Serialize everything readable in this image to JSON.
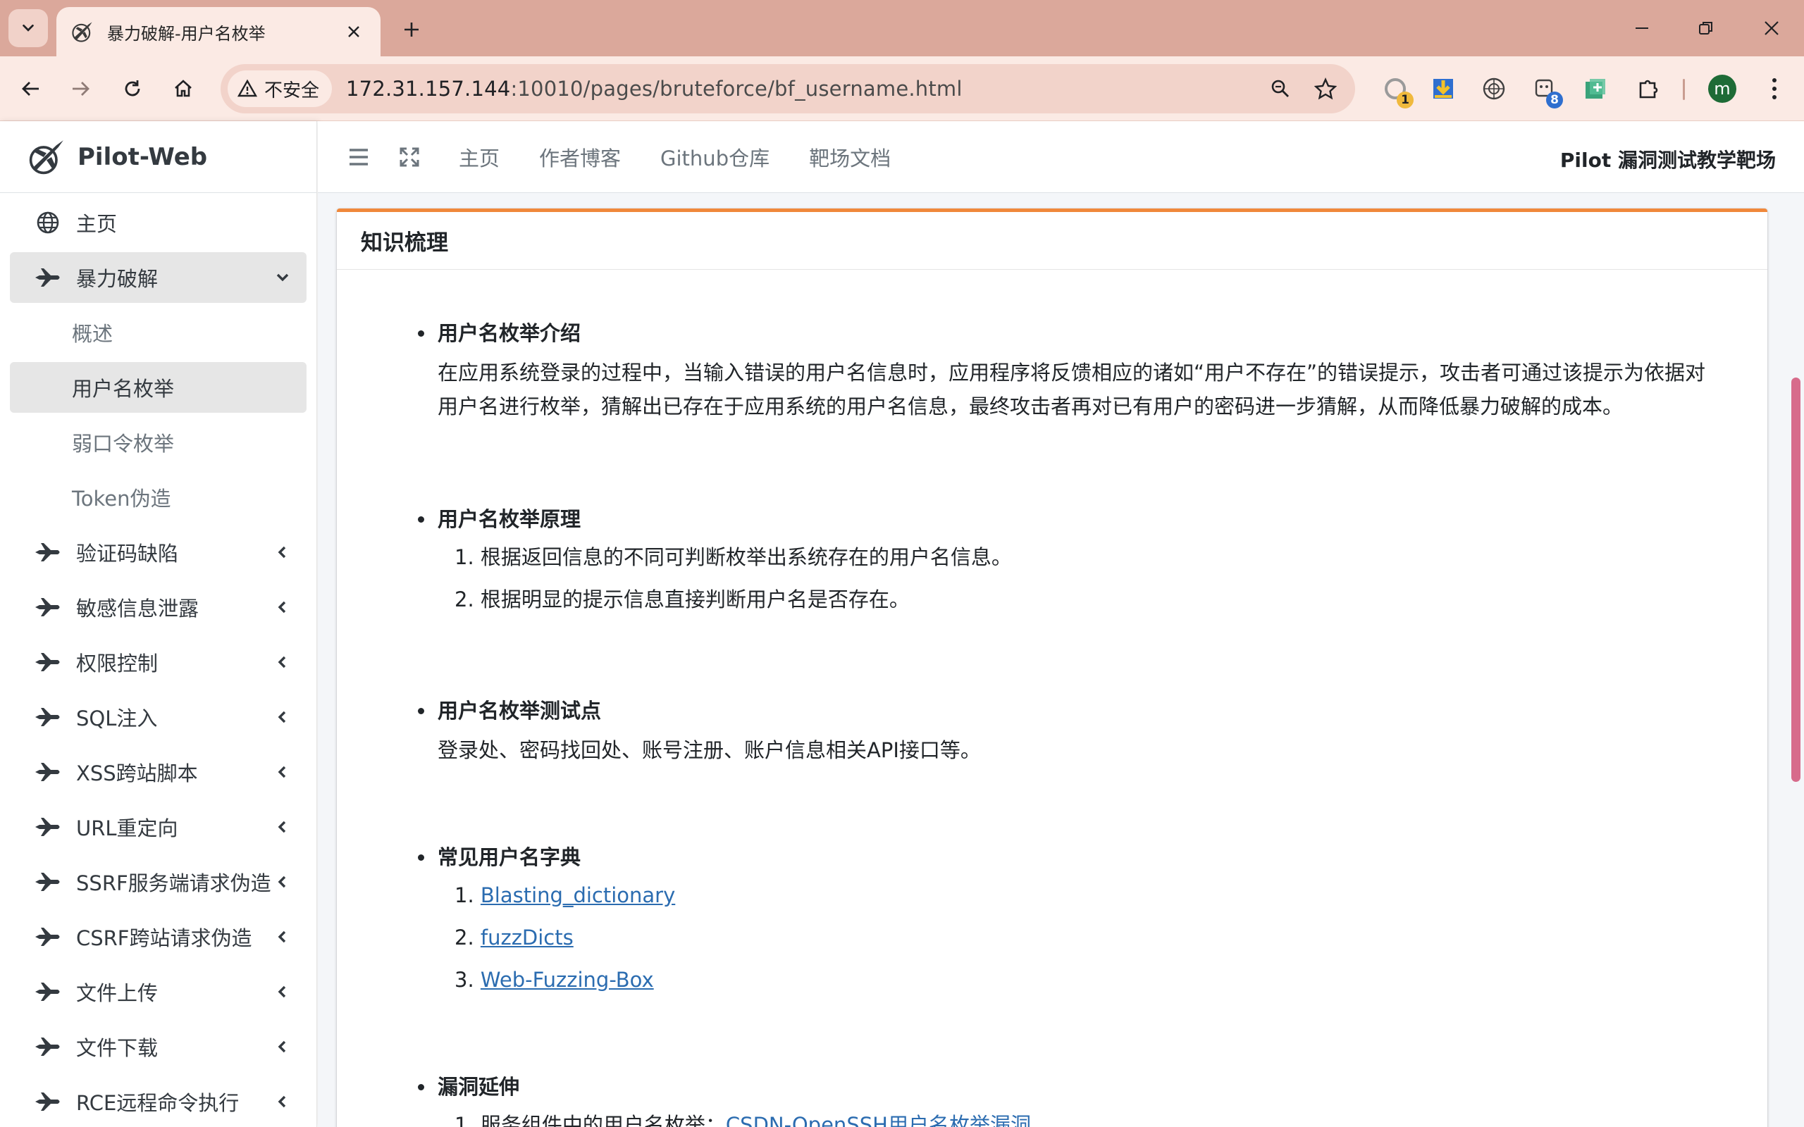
{
  "browser": {
    "tab_title": "暴力破解-用户名枚举",
    "security_label": "不安全",
    "url_host": "172.31.157.144",
    "url_path": ":10010/pages/bruteforce/bf_username.html",
    "avatar_letter": "m",
    "ext_badges": [
      "1",
      "8"
    ]
  },
  "sidebar": {
    "brand": "Pilot-Web",
    "home": "主页",
    "bruteforce": "暴力破解",
    "sub_items": [
      "概述",
      "用户名枚举",
      "弱口令枚举",
      "Token伪造"
    ],
    "menu": [
      "验证码缺陷",
      "敏感信息泄露",
      "权限控制",
      "SQL注入",
      "XSS跨站脚本",
      "URL重定向",
      "SSRF服务端请求伪造",
      "CSRF跨站请求伪造",
      "文件上传",
      "文件下载",
      "RCE远程命令执行"
    ]
  },
  "topnav": {
    "links": [
      "主页",
      "作者博客",
      "Github仓库",
      "靶场文档"
    ],
    "right_title": "Pilot 漏洞测试教学靶场"
  },
  "card": {
    "title": "知识梳理",
    "s1_title": "用户名枚举介绍",
    "s1_text": "在应用系统登录的过程中，当输入错误的用户名信息时，应用程序将反馈相应的诸如“用户不存在”的错误提示，攻击者可通过该提示为依据对用户名进行枚举，猜解出已存在于应用系统的用户名信息，最终攻击者再对已有用户的密码进一步猜解，从而降低暴力破解的成本。",
    "s2_title": "用户名枚举原理",
    "s2_items": [
      "根据返回信息的不同可判断枚举出系统存在的用户名信息。",
      "根据明显的提示信息直接判断用户名是否存在。"
    ],
    "s3_title": "用户名枚举测试点",
    "s3_text": "登录处、密码找回处、账号注册、账户信息相关API接口等。",
    "s4_title": "常见用户名字典",
    "s4_links": [
      "Blasting_dictionary",
      "fuzzDicts",
      "Web-Fuzzing-Box"
    ],
    "s5_title": "漏洞延伸",
    "s5_item_prefix": "服务组件中的用户名枚举：",
    "s5_item_link": "CSDN-OpenSSH用户名枚举漏洞"
  },
  "colors": {
    "tabstrip": "#dba89b",
    "toolbar": "#fbeae4",
    "card_accent": "#f0883b",
    "link": "#2b6cb0",
    "scroll_thumb": "#d76b8b"
  }
}
